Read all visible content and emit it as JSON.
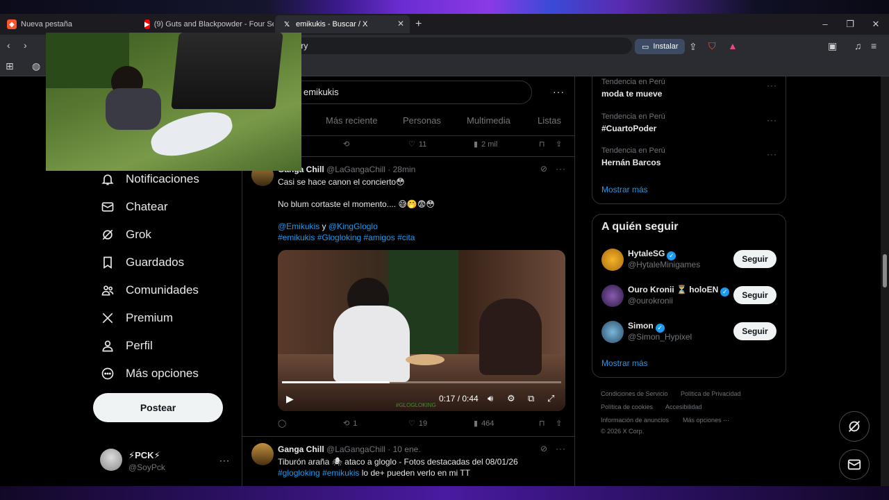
{
  "browser": {
    "tabs": [
      {
        "label": "Nueva pestaña",
        "icon": "brave-icon"
      },
      {
        "label": "(9) Guts and Blackpowder - Four Sea",
        "icon": "youtube-icon"
      },
      {
        "label": "emikukis - Buscar / X",
        "icon": "x-icon"
      }
    ],
    "url": "uery",
    "install_label": "Instalar"
  },
  "nav": {
    "items": [
      {
        "label": "Notificaciones",
        "icon": "bell-icon"
      },
      {
        "label": "Chatear",
        "icon": "mail-icon"
      },
      {
        "label": "Grok",
        "icon": "grok-icon"
      },
      {
        "label": "Guardados",
        "icon": "bookmark-icon"
      },
      {
        "label": "Comunidades",
        "icon": "people-icon"
      },
      {
        "label": "Premium",
        "icon": "x-icon"
      },
      {
        "label": "Perfil",
        "icon": "person-icon"
      },
      {
        "label": "Más opciones",
        "icon": "more-circle-icon"
      }
    ],
    "post_label": "Postear",
    "account": {
      "name": "⚡PCK⚡",
      "handle": "@SoyPck"
    }
  },
  "search": {
    "query": "emikukis",
    "tabs": [
      "Más reciente",
      "Personas",
      "Multimedia",
      "Listas"
    ]
  },
  "prev_tweet_actions": {
    "likes": "11",
    "views": "2 mil"
  },
  "tweet1": {
    "name": "Ganga Chill",
    "handle": "@LaGangaChill",
    "time": "· 28min",
    "line1": "Casi se hace canon el concierto😳",
    "line2": "No blum cortaste el momento.... 😅🤭😨😳",
    "mention1": "@Emikukis",
    "and": "y",
    "mention2": "@KingGloglo",
    "hashtags": [
      "#emikukis",
      "#Glogloking",
      "#amigos",
      "#cita"
    ],
    "video_time": "0:17 / 0:44",
    "video_watermark": "#GLOGLOKING",
    "retweets": "1",
    "likes": "19",
    "views": "464"
  },
  "tweet2": {
    "name": "Ganga Chill",
    "handle": "@LaGangaChill",
    "time": "· 10 ene.",
    "line1": "Tiburón araña 🕷 ataco a gloglo - Fotos destacadas del 08/01/26",
    "hashtag1": "#glogloking",
    "hashtag2": "#emikukis",
    "line2_rest": "lo de+ pueden verlo en mi TT"
  },
  "trends": [
    {
      "context": "Tendencia en Perú",
      "title": "moda te mueve"
    },
    {
      "context": "Tendencia en Perú",
      "title": "#CuartoPoder"
    },
    {
      "context": "Tendencia en Perú",
      "title": "Hernán Barcos"
    }
  ],
  "trends_show_more": "Mostrar más",
  "who_to_follow": {
    "title": "A quién seguir",
    "users": [
      {
        "name": "HytaleSG",
        "handle": "@HytaleMinigames",
        "button": "Seguir"
      },
      {
        "name": "Ouro Kronii ⏳ holoEN",
        "handle": "@ourokronii",
        "button": "Seguir"
      },
      {
        "name": "Simon",
        "handle": "@Simon_Hypixel",
        "button": "Seguir"
      }
    ],
    "show_more": "Mostrar más"
  },
  "footer": {
    "links": [
      "Condiciones de Servicio",
      "Política de Privacidad",
      "Política de cookies",
      "Accesibilidad",
      "Información de anuncios",
      "Más opciones ···"
    ],
    "copyright": "© 2026 X Corp."
  },
  "colors": {
    "accent": "#1d9bf0",
    "background": "#000000",
    "border": "#2f3336",
    "muted": "#71767b"
  }
}
